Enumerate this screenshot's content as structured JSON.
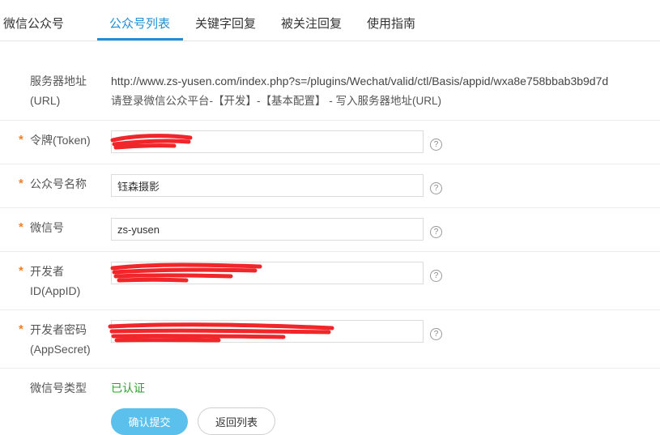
{
  "header": {
    "brand": "微信公众号",
    "tabs": [
      {
        "label": "公众号列表",
        "active": true
      },
      {
        "label": "关键字回复",
        "active": false
      },
      {
        "label": "被关注回复",
        "active": false
      },
      {
        "label": "使用指南",
        "active": false
      }
    ]
  },
  "form": {
    "server_url": {
      "label_line1": "服务器地址",
      "label_line2": "(URL)",
      "value": "http://www.zs-yusen.com/index.php?s=/plugins/Wechat/valid/ctl/Basis/appid/wxa8e758bbab3b9d7d",
      "hint": "请登录微信公众平台-【开发】-【基本配置】 - 写入服务器地址(URL)"
    },
    "token": {
      "label": "令牌(Token)",
      "value": "",
      "required": "*"
    },
    "account_name": {
      "label": "公众号名称",
      "value": "钰森摄影",
      "required": "*"
    },
    "wechat_id": {
      "label": "微信号",
      "value": "zs-yusen",
      "required": "*"
    },
    "app_id": {
      "label_line1": "开发者",
      "label_line2": "ID(AppID)",
      "value": "",
      "required": "*"
    },
    "app_secret": {
      "label_line1": "开发者密码",
      "label_line2": "(AppSecret)",
      "value": "",
      "required": "*"
    },
    "account_type": {
      "label": "微信号类型",
      "value": "已认证",
      "value_color": "#2ea02e"
    },
    "help_symbol": "?"
  },
  "actions": {
    "submit_label": "确认提交",
    "back_label": "返回列表"
  },
  "colors": {
    "accent": "#1e8fd8",
    "required_star": "#f0812b",
    "primary_button": "#5bc0eb",
    "redaction": "#f0262b"
  }
}
